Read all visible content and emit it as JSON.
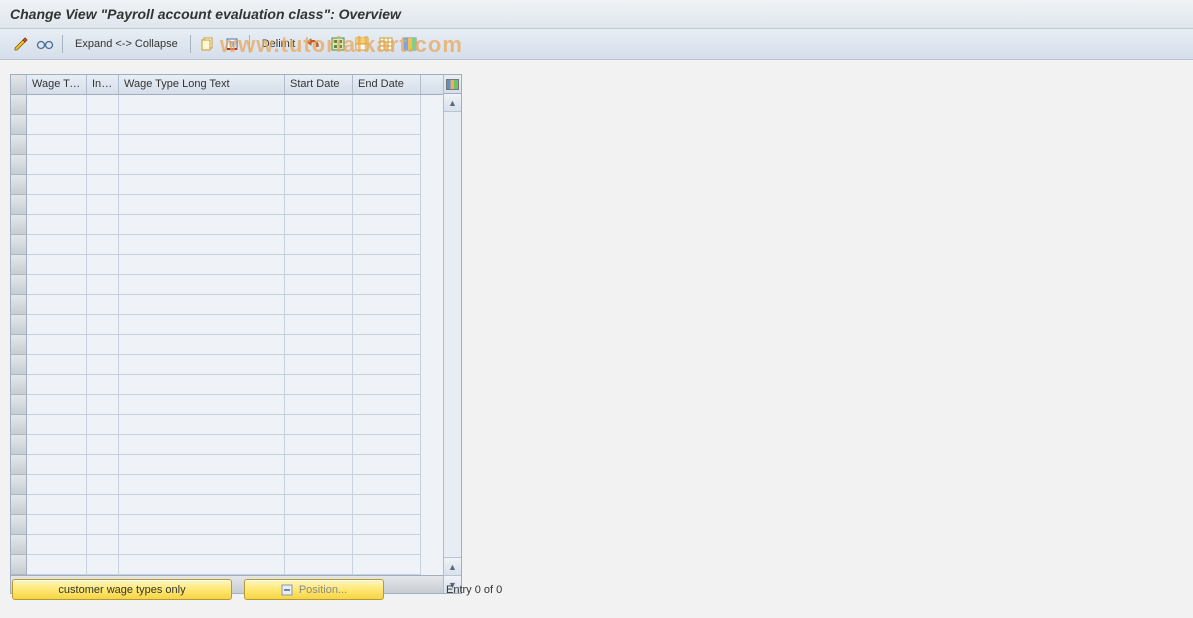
{
  "title": "Change View \"Payroll account evaluation class\": Overview",
  "toolbar": {
    "expand_collapse": "Expand <-> Collapse",
    "delimit": "Delimit"
  },
  "watermark": "www.tutorialkart.com",
  "table": {
    "columns": {
      "wage_type": "Wage Ty...",
      "inf": "Inf...",
      "long_text": "Wage Type Long Text",
      "start_date": "Start Date",
      "end_date": "End Date"
    },
    "row_count": 24
  },
  "footer": {
    "customer_btn": "customer wage types only",
    "position_btn": "Position...",
    "entry_text": "Entry 0 of 0"
  }
}
